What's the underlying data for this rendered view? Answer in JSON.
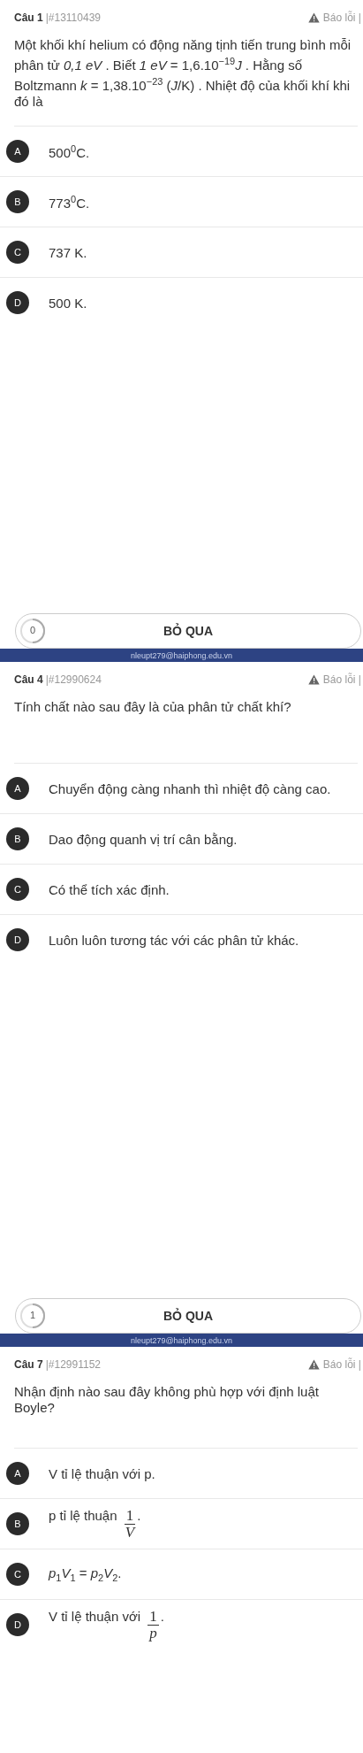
{
  "questions": [
    {
      "label": "Câu 1",
      "id": "|#13110439",
      "report": "Báo lỗi |",
      "text": "Một khối khí helium có động năng tịnh tiến trung bình mỗi phân tử *0,1 eV* . Biết *1 eV* = 1,6.10$^{−19}$*J* . Hằng số Boltzmann *k* = 1,38.10$^{−23}$ (*J*/K) . Nhiệt độ của khối khí khi đó là",
      "options": [
        {
          "letter": "A",
          "kind": "text",
          "text": "500$^{0}$C."
        },
        {
          "letter": "B",
          "kind": "text",
          "text": "773$^{0}$C."
        },
        {
          "letter": "C",
          "kind": "text",
          "text": "737 K."
        },
        {
          "letter": "D",
          "kind": "text",
          "text": "500 K."
        }
      ],
      "skip": {
        "count": "0",
        "label": "BỎ QUA"
      },
      "band": "nleupt279@haiphong.edu.vn"
    },
    {
      "label": "Câu 4",
      "id": "|#12990624",
      "report": "Báo lỗi |",
      "text": "Tính chất nào sau đây là của phân tử chất khí?",
      "options": [
        {
          "letter": "A",
          "kind": "text",
          "text": "Chuyển động càng nhanh thì nhiệt độ càng cao."
        },
        {
          "letter": "B",
          "kind": "text",
          "text": "Dao động quanh vị trí cân bằng."
        },
        {
          "letter": "C",
          "kind": "text",
          "text": "Có thể tích xác định."
        },
        {
          "letter": "D",
          "kind": "text",
          "text": "Luôn luôn tương tác với các phân tử khác."
        }
      ],
      "skip": {
        "count": "1",
        "label": "BỎ QUA"
      },
      "band": "nleupt279@haiphong.edu.vn"
    },
    {
      "label": "Câu 7",
      "id": "|#12991152",
      "report": "Báo lỗi |",
      "text": "Nhận định nào sau đây không phù hợp với định luật Boyle?",
      "options": [
        {
          "letter": "A",
          "kind": "text",
          "text": "V tỉ lệ thuận với p."
        },
        {
          "letter": "B",
          "kind": "fraction",
          "text": "p tỉ lệ thuận",
          "numerator": "1",
          "denominator": "V",
          "suffix": "."
        },
        {
          "letter": "C",
          "kind": "text",
          "text": "*p*$_{1}$*V*$_{1}$ = *p*$_{2}$*V*$_{2}$."
        },
        {
          "letter": "D",
          "kind": "fraction",
          "text": "V tỉ lệ thuận với",
          "numerator": "1",
          "denominator": "p",
          "suffix": "."
        }
      ]
    }
  ]
}
